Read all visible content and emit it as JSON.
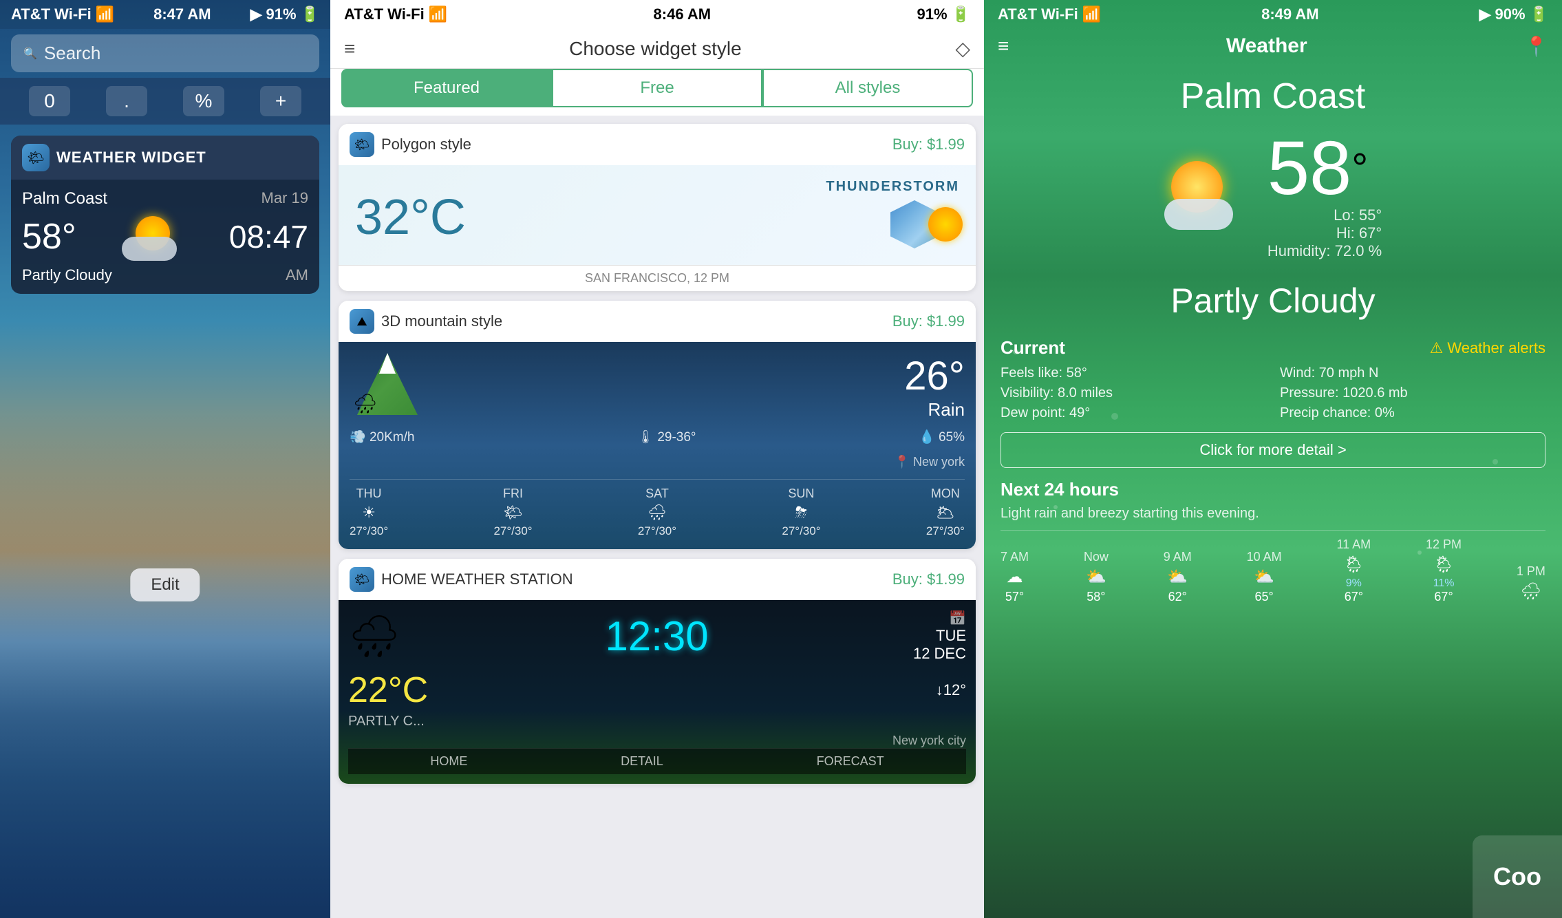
{
  "panel1": {
    "status_bar": {
      "carrier": "AT&T Wi-Fi",
      "wifi_signal": "●●●",
      "time": "8:47 AM",
      "location_arrow": "▶",
      "battery": "91%"
    },
    "search": {
      "placeholder": "Search"
    },
    "calculator": {
      "buttons": [
        "0",
        ".",
        "%",
        "+"
      ]
    },
    "widget": {
      "title": "WEATHER WIDGET",
      "location": "Palm Coast",
      "date": "Mar 19",
      "temperature": "58°",
      "time_display": "08:47",
      "am_pm": "AM",
      "description": "Partly Cloudy"
    },
    "edit_button": "Edit"
  },
  "panel2": {
    "status_bar": {
      "carrier": "AT&T Wi-Fi",
      "time": "8:46 AM",
      "battery": "91%"
    },
    "header": {
      "title": "Choose widget style",
      "left_icon": "≡",
      "right_icon": "◇"
    },
    "tabs": [
      "Featured",
      "Free",
      "All styles"
    ],
    "active_tab": 0,
    "widgets": [
      {
        "name": "Polygon style",
        "price": "Buy: $1.99",
        "preview_type": "polygon",
        "temp": "32°C",
        "condition": "THUNDERSTORM",
        "location": "SAN FRANCISCO, 12 PM"
      },
      {
        "name": "3D mountain style",
        "price": "Buy: $1.99",
        "preview_type": "mountain",
        "temp": "26°",
        "condition": "Rain",
        "stats": [
          "20Km/h",
          "29-36°",
          "65%"
        ],
        "location": "New york",
        "forecast": [
          {
            "day": "THU",
            "icon": "☀",
            "temp": "27°/30°"
          },
          {
            "day": "FRI",
            "icon": "🌤",
            "temp": "27°/30°"
          },
          {
            "day": "SAT",
            "icon": "🌧",
            "temp": "27°/30°"
          },
          {
            "day": "SUN",
            "icon": "⛈",
            "temp": "27°/30°"
          },
          {
            "day": "MON",
            "icon": "🌥",
            "temp": "27°/30°"
          }
        ]
      },
      {
        "name": "HOME WEATHER STATION",
        "price": "Buy: $1.99",
        "preview_type": "hws",
        "time_display": "12:30",
        "date_display": "TUE\n12 DEC",
        "temp": "22°C",
        "arrow_temp": "↓12°",
        "condition": "PARTLY C...",
        "city": "New york city",
        "nav_items": [
          "HOME",
          "DETAIL",
          "FORECAST"
        ]
      }
    ]
  },
  "panel3": {
    "status_bar": {
      "carrier": "AT&T Wi-Fi",
      "time": "8:49 AM",
      "battery": "90%"
    },
    "header": {
      "title": "Weather",
      "left_icon": "≡",
      "right_icon": "📍"
    },
    "city": "Palm Coast",
    "temperature": "58",
    "degree_symbol": "°",
    "lo": "Lo: 55°",
    "hi": "Hi: 67°",
    "humidity": "Humidity: 72.0 %",
    "description": "Partly Cloudy",
    "current": {
      "title": "Current",
      "alerts_label": "Weather alerts",
      "feels_like": "Feels like: 58°",
      "visibility": "Visibility: 8.0 miles",
      "dew_point": "Dew point: 49°",
      "wind": "Wind: 70 mph N",
      "pressure": "Pressure: 1020.6 mb",
      "precip": "Precip chance: 0%"
    },
    "click_more": "Click for more detail >",
    "next24": {
      "title": "Next 24 hours",
      "description": "Light rain and breezy starting this evening.",
      "hours": [
        {
          "time": "7 AM",
          "icon": "☁",
          "precip": "",
          "temp": "57°"
        },
        {
          "time": "Now",
          "icon": "⛅",
          "precip": "",
          "temp": "58°"
        },
        {
          "time": "9 AM",
          "icon": "⛅",
          "precip": "",
          "temp": "62°"
        },
        {
          "time": "10 AM",
          "icon": "⛅",
          "precip": "",
          "temp": "65°"
        },
        {
          "time": "11 AM",
          "icon": "🌦",
          "precip": "9%",
          "temp": "67°"
        },
        {
          "time": "12 PM",
          "icon": "🌦",
          "precip": "11%",
          "temp": "67°"
        },
        {
          "time": "1 PM",
          "icon": "🌧",
          "precip": "",
          "temp": ""
        }
      ]
    }
  }
}
